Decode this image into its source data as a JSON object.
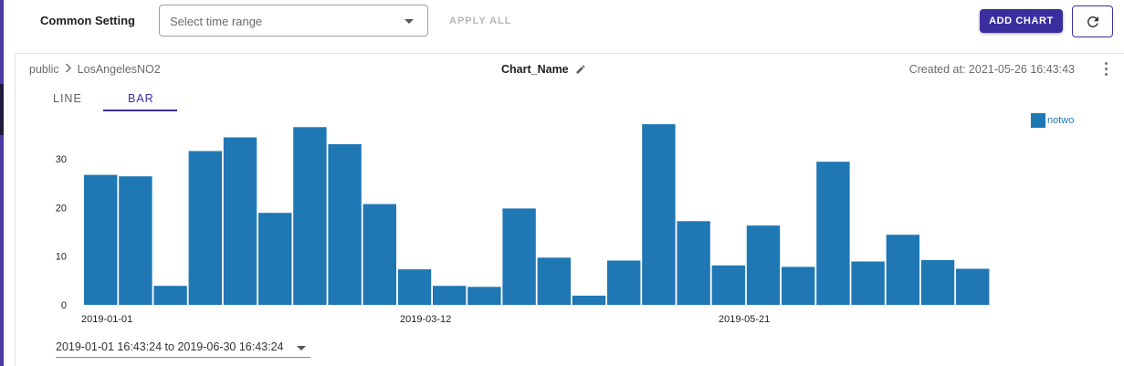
{
  "toolbar": {
    "common_setting_label": "Common Setting",
    "time_range_placeholder": "Select time range",
    "apply_all_label": "APPLY ALL",
    "add_chart_label": "ADD CHART",
    "refresh_icon": "refresh-icon"
  },
  "chart_card": {
    "breadcrumb": {
      "schema": "public",
      "separator_icon": "chevron-right-icon",
      "table": "LosAngelesNO2"
    },
    "name": "Chart_Name",
    "edit_icon": "pencil-icon",
    "created_at": "Created at: 2021-05-26 16:43:43",
    "menu_icon": "more-vert-icon",
    "tabs": [
      {
        "label": "LINE",
        "active": false
      },
      {
        "label": "BAR",
        "active": true
      }
    ],
    "range_value": "2019-01-01 16:43:24 to 2019-06-30 16:43:24"
  },
  "colors": {
    "accent": "#3a2e9f",
    "bar": "#1f77b4"
  },
  "chart_data": {
    "type": "bar",
    "series": [
      {
        "name": "notwo",
        "values": [
          26.7,
          26.4,
          3.9,
          31.6,
          34.4,
          18.9,
          36.5,
          33.0,
          20.7,
          7.3,
          3.9,
          3.7,
          19.8,
          9.7,
          1.9,
          9.1,
          37.1,
          17.2,
          8.1,
          16.3,
          7.8,
          29.4,
          8.9,
          14.4,
          9.2,
          7.4
        ]
      }
    ],
    "x_tick_labels": [
      "2019-01-01",
      "2019-03-12",
      "2019-05-21"
    ],
    "x_tick_bar_index": [
      0,
      10,
      20
    ],
    "y_ticks": [
      0,
      10,
      20,
      30
    ],
    "ylim": [
      0,
      40
    ],
    "legend": "top-right",
    "grid": false,
    "title": "",
    "xlabel": "",
    "ylabel": ""
  }
}
